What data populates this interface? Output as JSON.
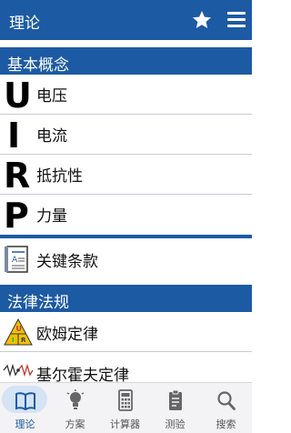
{
  "appbar": {
    "title": "理论",
    "star_icon": "star-icon",
    "menu_icon": "menu-icon"
  },
  "section_basic": {
    "title": "基本概念"
  },
  "concepts": [
    {
      "letter": "U",
      "label": "电压"
    },
    {
      "letter": "I",
      "label": "电流"
    },
    {
      "letter": "R",
      "label": "抵抗性"
    },
    {
      "letter": "P",
      "label": "力量"
    }
  ],
  "key_terms": {
    "label": "关键条款",
    "icon": "document-icon"
  },
  "section_laws": {
    "title": "法律法规"
  },
  "laws": [
    {
      "label": "欧姆定律",
      "icon": "ohm-triangle-icon"
    },
    {
      "label": "基尔霍夫定律",
      "icon": "circuit-icon"
    }
  ],
  "tabs": [
    {
      "label": "理论",
      "icon": "book-icon",
      "active": true
    },
    {
      "label": "方案",
      "icon": "lightbulb-icon",
      "active": false
    },
    {
      "label": "计算器",
      "icon": "calculator-icon",
      "active": false
    },
    {
      "label": "测验",
      "icon": "clipboard-icon",
      "active": false
    },
    {
      "label": "搜索",
      "icon": "search-icon",
      "active": false
    }
  ],
  "colors": {
    "primary": "#1c5aa3",
    "active_pill": "#d5e3f6",
    "tabbar_bg": "#f3f3f5"
  }
}
